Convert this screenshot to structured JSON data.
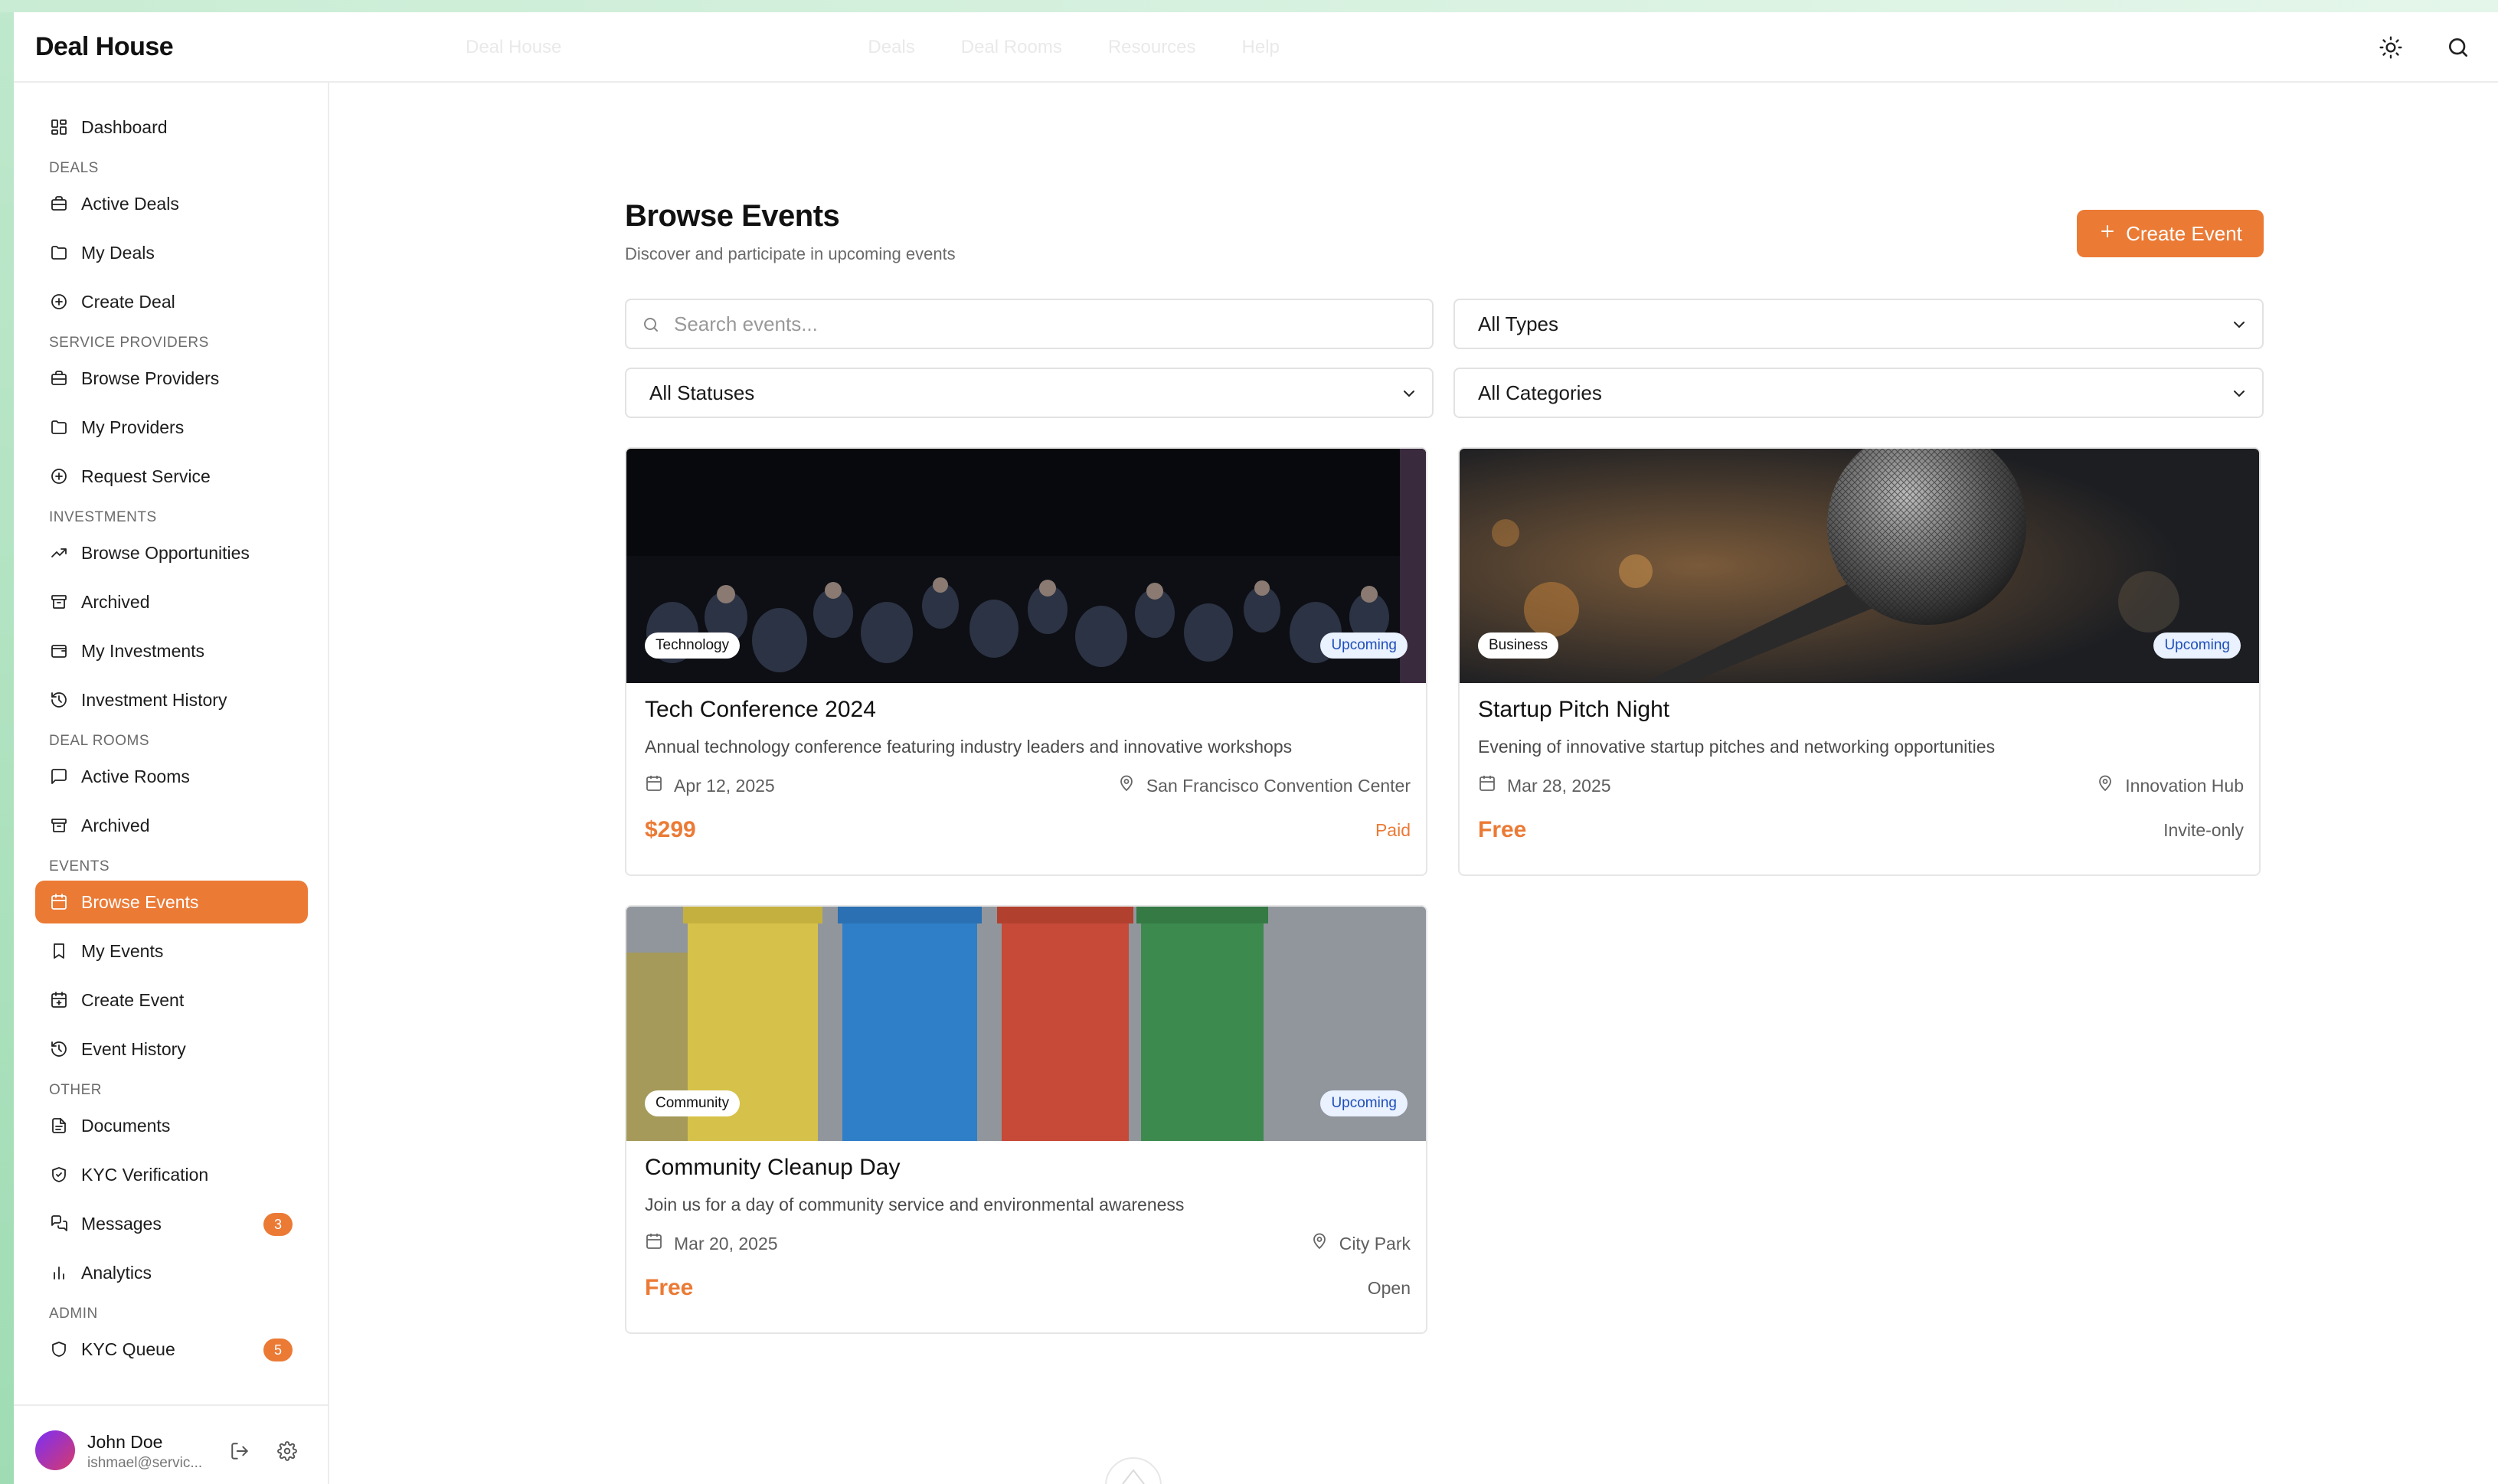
{
  "app": {
    "brand": "Deal House"
  },
  "header": {
    "ghost_items": [
      "Deal House",
      "Deals",
      "Deal Rooms",
      "Resources",
      "Help"
    ]
  },
  "sidebar": {
    "dashboard": "Dashboard",
    "sections": [
      {
        "label": "DEALS",
        "items": [
          {
            "label": "Active Deals",
            "icon": "briefcase-icon"
          },
          {
            "label": "My Deals",
            "icon": "folder-icon"
          },
          {
            "label": "Create Deal",
            "icon": "plus-circle-icon"
          }
        ]
      },
      {
        "label": "SERVICE PROVIDERS",
        "items": [
          {
            "label": "Browse Providers",
            "icon": "briefcase-icon"
          },
          {
            "label": "My Providers",
            "icon": "folder-icon"
          },
          {
            "label": "Request Service",
            "icon": "plus-circle-icon"
          }
        ]
      },
      {
        "label": "INVESTMENTS",
        "items": [
          {
            "label": "Browse Opportunities",
            "icon": "trending-up-icon"
          },
          {
            "label": "Archived",
            "icon": "archive-icon"
          },
          {
            "label": "My Investments",
            "icon": "wallet-icon"
          },
          {
            "label": "Investment History",
            "icon": "history-icon"
          }
        ]
      },
      {
        "label": "DEAL ROOMS",
        "items": [
          {
            "label": "Active Rooms",
            "icon": "message-square-icon"
          },
          {
            "label": "Archived",
            "icon": "archive-icon"
          }
        ]
      },
      {
        "label": "EVENTS",
        "items": [
          {
            "label": "Browse Events",
            "icon": "calendar-icon",
            "active": true
          },
          {
            "label": "My Events",
            "icon": "bookmark-icon"
          },
          {
            "label": "Create Event",
            "icon": "calendar-plus-icon"
          },
          {
            "label": "Event History",
            "icon": "history-icon"
          }
        ]
      },
      {
        "label": "OTHER",
        "items": [
          {
            "label": "Documents",
            "icon": "file-text-icon"
          },
          {
            "label": "KYC Verification",
            "icon": "shield-check-icon"
          },
          {
            "label": "Messages",
            "icon": "messages-icon",
            "badge": "3"
          },
          {
            "label": "Analytics",
            "icon": "bar-chart-icon"
          }
        ]
      },
      {
        "label": "ADMIN",
        "items": [
          {
            "label": "KYC Queue",
            "icon": "shield-icon",
            "badge": "5"
          }
        ]
      }
    ],
    "user": {
      "name": "John Doe",
      "email": "ishmael@servic..."
    }
  },
  "main": {
    "title": "Browse Events",
    "subtitle": "Discover and participate in upcoming events",
    "create_button": "Create Event",
    "search_placeholder": "Search events...",
    "type_filter": "All Types",
    "status_filter": "All Statuses",
    "category_filter": "All Categories",
    "events": [
      {
        "title": "Tech Conference 2024",
        "description": "Annual technology conference featuring industry leaders and innovative workshops",
        "category": "Technology",
        "status": "Upcoming",
        "date": "Apr 12, 2025",
        "location": "San Francisco Convention Center",
        "price": "$299",
        "access": "Paid",
        "access_color": "#eb7a35"
      },
      {
        "title": "Startup Pitch Night",
        "description": "Evening of innovative startup pitches and networking opportunities",
        "category": "Business",
        "status": "Upcoming",
        "date": "Mar 28, 2025",
        "location": "Innovation Hub",
        "price": "Free",
        "access": "Invite-only",
        "access_color": "#5e5e5e"
      },
      {
        "title": "Community Cleanup Day",
        "description": "Join us for a day of community service and environmental awareness",
        "category": "Community",
        "status": "Upcoming",
        "date": "Mar 20, 2025",
        "location": "City Park",
        "price": "Free",
        "access": "Open",
        "access_color": "#5e5e5e"
      }
    ]
  },
  "colors": {
    "accent": "#eb7a35",
    "status_bg": "#eaf1ff",
    "status_text": "#1e4fb8"
  }
}
